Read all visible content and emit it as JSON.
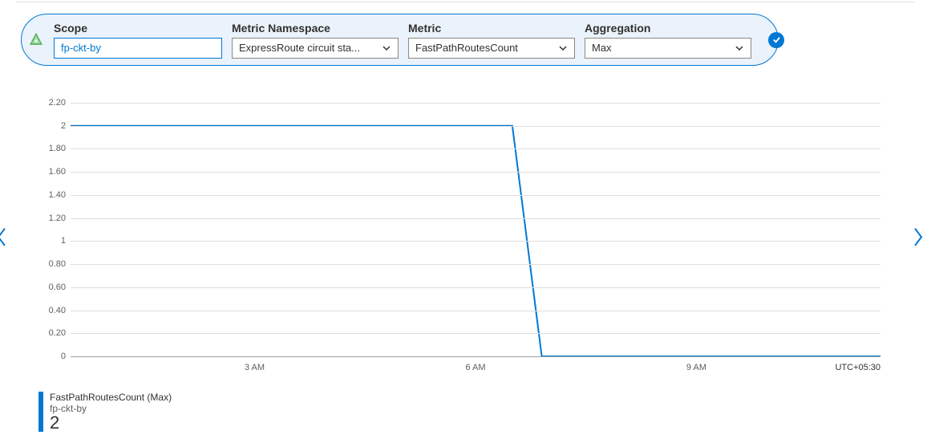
{
  "filters": {
    "scope": {
      "label": "Scope",
      "value": "fp-ckt-by"
    },
    "namespace": {
      "label": "Metric Namespace",
      "value": "ExpressRoute circuit sta..."
    },
    "metric": {
      "label": "Metric",
      "value": "FastPathRoutesCount"
    },
    "aggregation": {
      "label": "Aggregation",
      "value": "Max"
    }
  },
  "legend": {
    "title": "FastPathRoutesCount (Max)",
    "resource": "fp-ckt-by",
    "value": "2"
  },
  "timezone": "UTC+05:30",
  "chart_data": {
    "type": "line",
    "title": "",
    "xlabel": "",
    "ylabel": "",
    "ylim": [
      0,
      2.2
    ],
    "y_ticks": [
      0,
      0.2,
      0.4,
      0.6,
      0.8,
      1,
      1.2,
      1.4,
      1.6,
      1.8,
      2,
      2.2
    ],
    "y_tick_labels": [
      "0",
      "0.20",
      "0.40",
      "0.60",
      "0.80",
      "1",
      "1.20",
      "1.40",
      "1.60",
      "1.80",
      "2",
      "2.20"
    ],
    "x_range_hours": [
      0.5,
      11.5
    ],
    "x_ticks_hours": [
      3,
      6,
      9
    ],
    "x_tick_labels": [
      "3 AM",
      "6 AM",
      "9 AM"
    ],
    "series": [
      {
        "name": "FastPathRoutesCount (Max)",
        "color": "#0078d4",
        "points_hours_y": [
          [
            0.5,
            2
          ],
          [
            6.5,
            2
          ],
          [
            6.9,
            0
          ],
          [
            11.5,
            0
          ]
        ]
      }
    ]
  }
}
